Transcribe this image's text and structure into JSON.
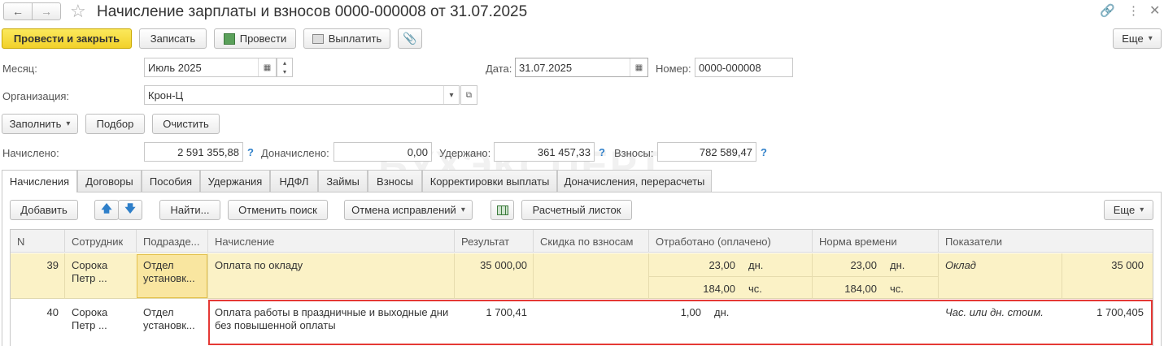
{
  "window": {
    "title": "Начисление зарплаты и взносов 0000-000008 от 31.07.2025"
  },
  "toolbar": {
    "post_close": "Провести и закрыть",
    "save": "Записать",
    "post": "Провести",
    "pay": "Выплатить",
    "more": "Еще"
  },
  "form": {
    "month_label": "Месяц:",
    "month_value": "Июль 2025",
    "date_label": "Дата:",
    "date_value": "31.07.2025",
    "number_label": "Номер:",
    "number_value": "0000-000008",
    "org_label": "Организация:",
    "org_value": "Крон-Ц"
  },
  "actions": {
    "fill": "Заполнить",
    "select": "Подбор",
    "clear": "Очистить"
  },
  "totals": {
    "accrued_label": "Начислено:",
    "accrued_value": "2 591 355,88",
    "extra_label": "Доначислено:",
    "extra_value": "0,00",
    "withheld_label": "Удержано:",
    "withheld_value": "361 457,33",
    "contrib_label": "Взносы:",
    "contrib_value": "782 589,47",
    "help": "?"
  },
  "watermark": "БУХЭКСПЕРТ",
  "tabs": [
    "Начисления",
    "Договоры",
    "Пособия",
    "Удержания",
    "НДФЛ",
    "Займы",
    "Взносы",
    "Корректировки выплаты",
    "Доначисления, перерасчеты"
  ],
  "grid_toolbar": {
    "add": "Добавить",
    "find": "Найти...",
    "cancel_search": "Отменить поиск",
    "cancel_fix": "Отмена исправлений",
    "payslip": "Расчетный листок",
    "more": "Еще"
  },
  "columns": [
    "N",
    "Сотрудник",
    "Подразде...",
    "Начисление",
    "Результат",
    "Скидка по взносам",
    "Отработано (оплачено)",
    "Норма времени",
    "Показатели"
  ],
  "rows": [
    {
      "n": "39",
      "employee": [
        "Сорока",
        "Петр ..."
      ],
      "dept": [
        "Отдел",
        "установк..."
      ],
      "accrual": "Оплата по окладу",
      "result": "35 000,00",
      "discount": "",
      "worked1": "23,00",
      "worked1_unit": "дн.",
      "worked2": "184,00",
      "worked2_unit": "чс.",
      "norm1": "23,00",
      "norm1_unit": "дн.",
      "norm2": "184,00",
      "norm2_unit": "чс.",
      "indicator": "Оклад",
      "indicator_value": "35 000"
    },
    {
      "n": "40",
      "employee": [
        "Сорока",
        "Петр ..."
      ],
      "dept": [
        "Отдел",
        "установк..."
      ],
      "accrual": [
        "Оплата работы в праздничные и выходные дни",
        "без повышенной оплаты"
      ],
      "result": "1 700,41",
      "worked1": "1,00",
      "worked1_unit": "дн.",
      "indicator": "Час. или дн. стоим.",
      "indicator_value": "1 700,405"
    }
  ]
}
